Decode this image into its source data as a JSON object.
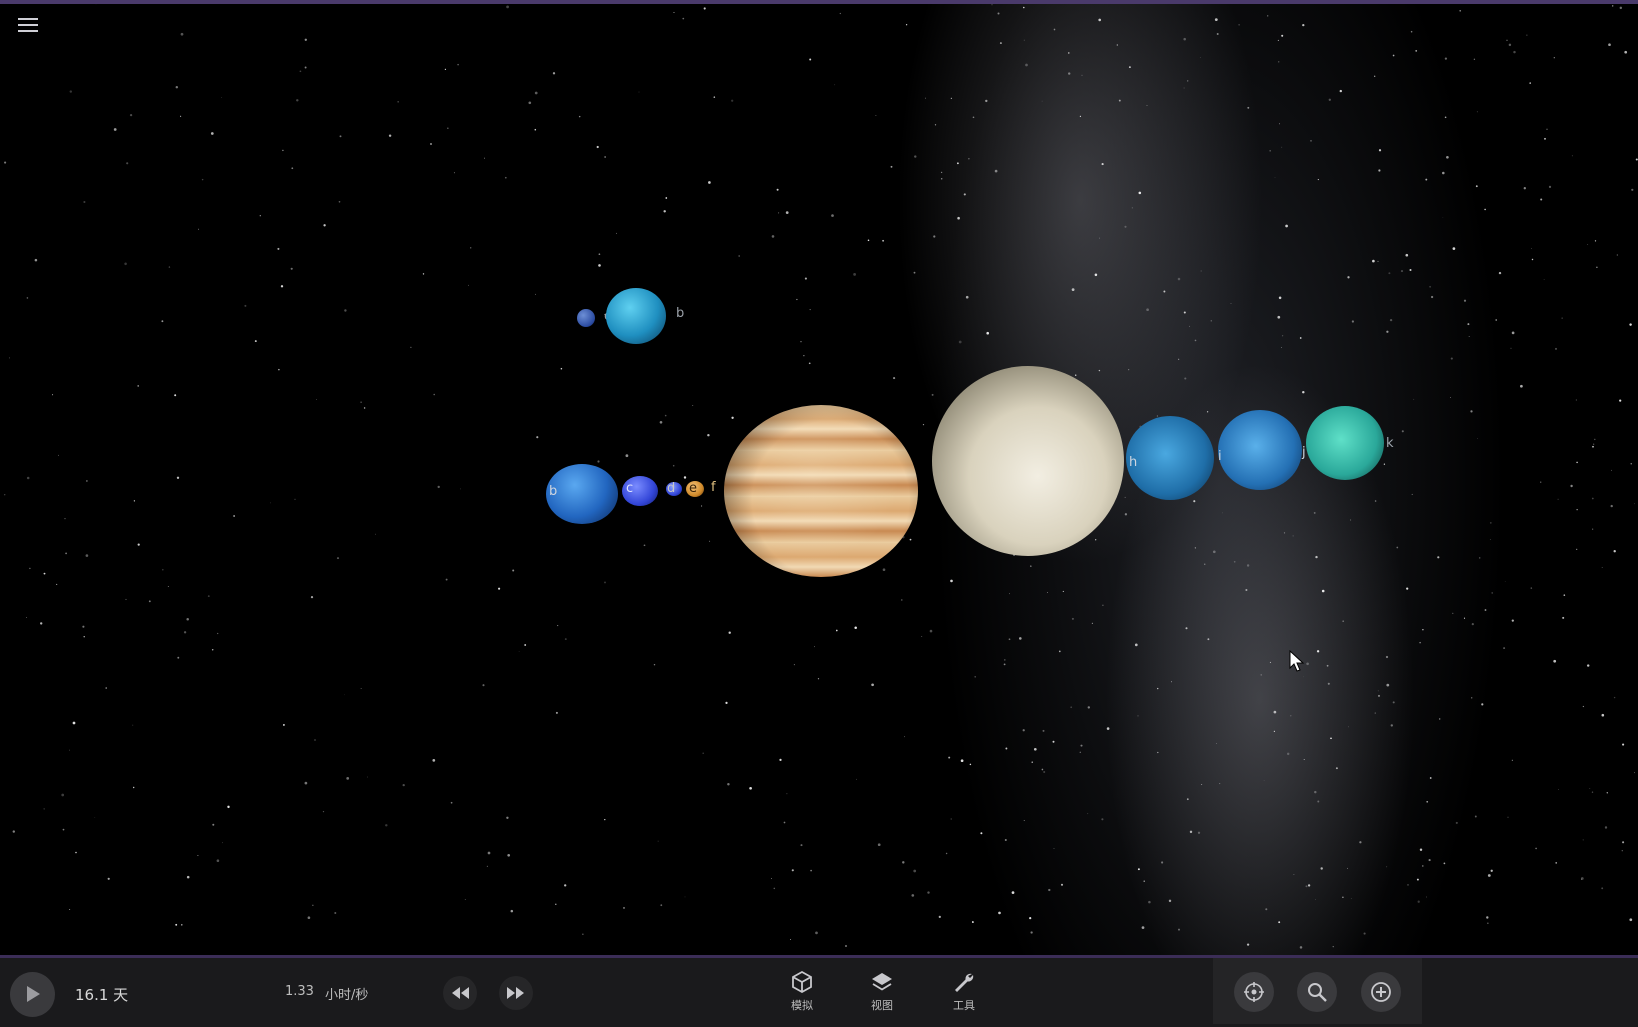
{
  "app": {
    "accent_color": "#4a3a6b"
  },
  "viewport": {
    "menu_icon": "hamburger-menu-icon",
    "planet_labels_top": [
      "c",
      "b"
    ],
    "planet_labels_main": [
      "b",
      "c",
      "d",
      "e",
      "f",
      "h",
      "i",
      "j",
      "k"
    ]
  },
  "bottombar": {
    "play_icon": "play-icon",
    "elapsed_time": "16.1 天",
    "rate_value": "1.33",
    "rate_unit": "小时/秒",
    "rewind_icon": "rewind-icon",
    "fastforward_icon": "fast-forward-icon",
    "tools": [
      {
        "label": "模拟",
        "icon": "cube-icon"
      },
      {
        "label": "视图",
        "icon": "layers-icon"
      },
      {
        "label": "工具",
        "icon": "wrench-icon"
      }
    ],
    "right_buttons": [
      "recenter-icon",
      "search-icon",
      "add-icon"
    ]
  }
}
